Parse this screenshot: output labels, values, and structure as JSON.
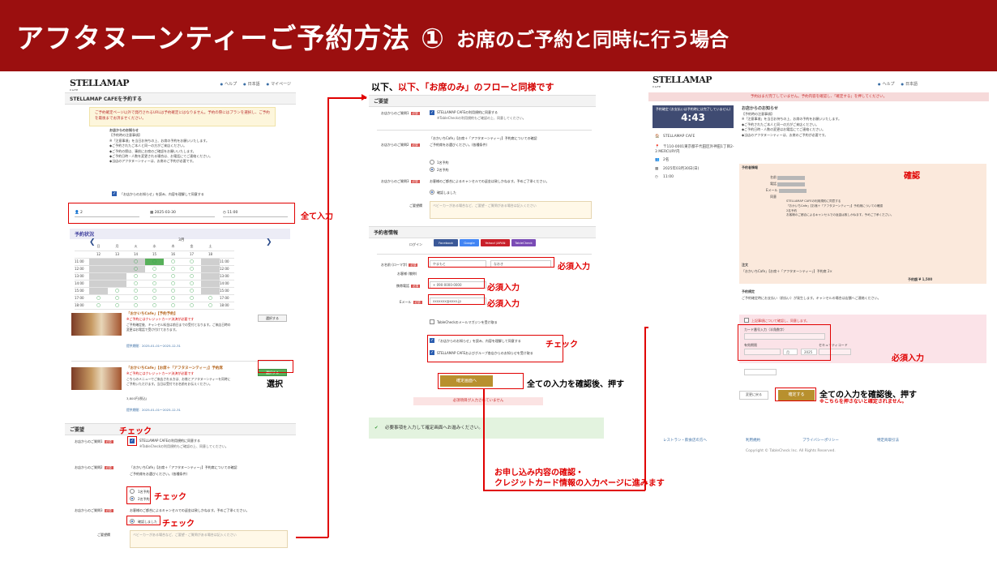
{
  "banner": {
    "title": "アフタヌーンティーご予約方法 ①",
    "subtitle": "お席のご予約と同時に行う場合"
  },
  "panel1": {
    "logo": "STELLAMAP",
    "logo_sub": "CAFE",
    "nav": [
      "ヘルプ",
      "日本語",
      "マイページ"
    ],
    "section_title": "STELLAMAP CAFEを予約する",
    "warning": "ご予約確定ページ以外で発行されるURLは予約確定にはなりません。予約の際にはプランを選択し、ご予約を最後までお済ませください。",
    "notice_heading": "お店からのお知らせ",
    "notice_lines": [
      "【予約時の注意事項】",
      "※「注意事項」を当日お持ちの上、お席の予約をお願いいたします。",
      "◆ご予約されたご本人と同一の方がご来店ください。",
      "◆ご予約の際は、事前にお席のご確認をお願いいたします。",
      "◆ご予約日時・人数を変更される場合は、お電話にてご連絡ください。",
      "◆当店のアフタヌーンティーは、お席のご予約が必要です。"
    ],
    "agree_label": "「お店からのお知らせ」を読み、内容を理解して同意する",
    "guests_value": "2",
    "date_value": "2025-03-30",
    "time_value": "11:00",
    "calendar_title": "予約状況",
    "calendar_month": "3月",
    "calendar_days": [
      "日",
      "月",
      "火",
      "水",
      "木",
      "金",
      "土"
    ],
    "calendar_dates": [
      "12",
      "13",
      "14",
      "15",
      "16",
      "17",
      "18"
    ],
    "calendar_times": [
      "11:00",
      "12:00",
      "13:00",
      "14:00",
      "15:00",
      "17:00",
      "18:00"
    ],
    "plan1_title": "「おかいちCafe」【予約予約】",
    "plan1_sub": "※ご予約にはクレジットカード決済が必要です",
    "plan1_body": "ご予約確定後、キャンセル料金は前日までの受付となります。ご来店日時の変更はお電話で受け付けております。",
    "plan1_btn": "選択する",
    "plan1_meta": "提供期間：2025-01-01〜2025-12-31",
    "plan2_title": "「おかいちCafe」【お席＋「アフタヌーンティー」】予約席",
    "plan2_sub": "※ご予約にはクレジットカード決済が必要です",
    "plan2_body": "こちらのメニューでご来店される方は、お席とアフタヌーンティーを同時にご予約いただけます。当日は受付でお名前をお伝えください。",
    "plan2_price": "3,800円(税込)",
    "plan2_btn": "選択する",
    "plan2_meta": "提供期間：2025-01-01〜2025-12-31",
    "request_title": "ご要望",
    "req_q1": "お店からのご質問1",
    "req_q1_answer": "STELLAMAP CAFEの利用規約に同意する",
    "req_q1_note": "※TableCheckの利用規約もご確認の上、同意してください。",
    "req_q2": "お店からのご質問2",
    "req_q2_heading": "「おかいちCafe」【お席＋「アフタヌーンティー」】予約席についての確認",
    "req_q2_text": "ご予約席をお選びください。(各種条件)",
    "req_q2_opt1": "1名予約",
    "req_q2_opt2": "2名予約",
    "req_q3": "お店からのご質問3",
    "req_q3_text": "お客様のご都合によるキャンセルでの返金は致しかねます。予めご了承ください。",
    "req_q3_opt": "確認しました",
    "req_memo": "ご要望欄",
    "req_memo_placeholder": "ベビーカーがある場合など、ご要望・ご質問がある場合は記入ください"
  },
  "panel2": {
    "section_title": "ご要望",
    "q1": "お店からのご質問1",
    "q1_answer": "STELLAMAP CAFEの利用規約に同意する",
    "q1_note": "※TableCheckの利用規約もご確認の上、同意してください。",
    "q2": "お店からのご質問2",
    "q2_heading": "「おかいちCafe」【お席＋「アフタヌーンティー」】予約席についての確認",
    "q2_text": "ご予約席をお選びください。(各種条件)",
    "q2_opt1": "1名予約",
    "q2_opt2": "2名予約",
    "q3": "お店からのご質問3",
    "q3_text": "お客様のご都合によるキャンセルでの返金は致しかねます。予めご了承ください。",
    "q3_opt": "確認しました",
    "memo": "ご要望欄",
    "memo_placeholder": "ベビーカーがある場合など、ご要望・ご質問がある場合は記入ください",
    "reserver_title": "予約者情報",
    "login_label": "ログイン",
    "sns": [
      "Facebook",
      "Google",
      "Yahoo! JAPAN",
      "TableCheck"
    ],
    "name_label": "お名前 (ローマ字)",
    "name_last": "やまもと",
    "name_first": "なおき",
    "gender_label": "お客様 (敬称)",
    "phone_label": "携帯電話",
    "phone_value": "+ 090-0000-0000",
    "email_label": "Eメール",
    "email_value": "xxxxxxx@xxxx.jp",
    "tablecheck_opt": "TableCheckのメールマガジンを受け取る",
    "agree1": "「お店からのお知らせ」を読み、内容を理解して同意する",
    "agree2": "STELLAMAP CAFEおよびグループ各店からのお知らせを受け取る",
    "confirm_btn": "確定画面へ",
    "error_text": "必須項目が入力されていません",
    "ok_text": "必要事項を入力して確定画面へお進みください。"
  },
  "panel3": {
    "top_notice": "予約はまだ完了していません。予約内容を確認し、「確定する」を押してください。",
    "booking_label": "予約確定 (お支払いは予約時には完了していません)",
    "time": "4:43",
    "venue": "STELLAMAP CAFE",
    "address": "〒110-0001東京都千代田区外神田1丁目2-3 MERCURY内",
    "guests": "2名",
    "date": "2025年03月30日(日)",
    "time_slot": "11:00",
    "notice_heading": "お店からのお知らせ",
    "notice_lines": [
      "【予約時の注意事項】",
      "※「注意事項」を当日お持ちの上、お席の予約をお願いいたします。",
      "◆ご予約されたご本人と同一の方がご来店ください。",
      "◆ご予約日時・人数の変更はお電話にてご連絡ください。",
      "◆当店のアフタヌーンティーは、お席のご予約が必要です。"
    ],
    "reserver_info": "予約者情報",
    "confirm_label": "確認",
    "rows": [
      "名前",
      "電話",
      "Eメール",
      "同意"
    ],
    "order_label": "注文",
    "order_item": "「おかいちCafe」【お席＋「アフタヌーンティー」】予約席",
    "order_qty": "2×",
    "order_total": "予約額 ¥ 1,500",
    "card_policy_title": "予約規定",
    "card_policy": "ご予約確定時にお支払い（前払い）が発生します。キャンセルの場合は店舗へご連絡ください。",
    "card_check": "上記事項について確認し、同意します。",
    "card_number_label": "カード番号入力（半角数字）",
    "card_exp_label": "有効期限",
    "card_cvc_label": "セキュリティコード",
    "card_month": "月",
    "card_year": "2025",
    "back_btn": "変更に戻る",
    "confirm_btn": "確定する",
    "footer": [
      "レストラン・飲食店の方へ",
      "利用規約",
      "プライバシーポリシー",
      "特定商取引法"
    ],
    "copyright": "Copyright © TableCheck Inc. All Rights Reserved."
  },
  "annotations": {
    "same_flow": "以下、「お席のみ」のフローと同様です",
    "all_input": "全て入力",
    "select": "選択",
    "check1": "チェック",
    "check2": "チェック",
    "check3": "チェック",
    "required1": "必須入力",
    "required2": "必須入力",
    "required3": "必須入力",
    "check_mid": "チェック",
    "confirm_push": "全ての入力を確認後、押す",
    "next_page_line1": "お申し込み内容の確認・",
    "next_page_line2": "クレジットカード情報の入力ページに進みます",
    "confirm_label": "確認",
    "required_card": "必須入力",
    "final_push": "全ての入力を確認後、押す",
    "final_note": "※こちらを押さないと確定されません。"
  },
  "colors": {
    "banner": "#9b0f0f",
    "annotation": "#e00000",
    "confirm_button": "#b8902e",
    "time_box": "#3f4b72"
  }
}
